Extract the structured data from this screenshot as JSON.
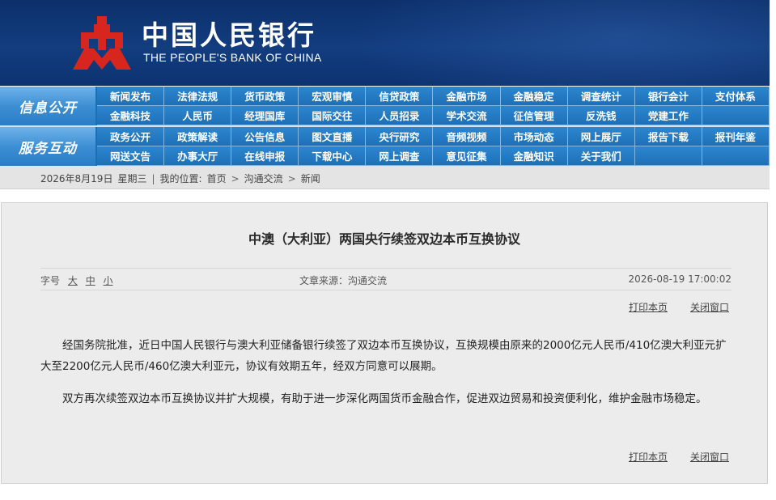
{
  "header": {
    "bank_name_cn": "中国人民银行",
    "bank_name_en": "THE PEOPLE'S BANK OF CHINA",
    "logo_icon": "pboc-logo-icon",
    "logo_color": "#d7261e"
  },
  "nav": {
    "info_label": "信息公开",
    "interact_label": "服务互动",
    "info_items": [
      "新闻发布",
      "法律法规",
      "货币政策",
      "宏观审慎",
      "信贷政策",
      "金融市场",
      "金融稳定",
      "调查统计",
      "银行会计",
      "支付体系",
      "金融科技",
      "人民币",
      "经理国库",
      "国际交往",
      "人员招录",
      "学术交流",
      "征信管理",
      "反洗钱",
      "党建工作",
      ""
    ],
    "interact_items": [
      "政务公开",
      "政策解读",
      "公告信息",
      "图文直播",
      "央行研究",
      "音频视频",
      "市场动态",
      "网上展厅",
      "报告下载",
      "报刊年鉴",
      "网送文告",
      "办事大厅",
      "在线申报",
      "下载中心",
      "网上调查",
      "意见征集",
      "金融知识",
      "关于我们",
      "",
      ""
    ]
  },
  "breadcrumb": {
    "date": "2026年8月19日",
    "weekday": "星期三",
    "divider": "|",
    "location_label": "我的位置:",
    "home": "首页",
    "arrow": ">",
    "section": "沟通交流",
    "page": "新闻"
  },
  "article": {
    "title": "中澳（大利亚）两国央行续签双边本币互换协议",
    "font_size_label": "字号",
    "font_large": "大",
    "font_medium": "中",
    "font_small": "小",
    "source": "文章来源：沟通交流",
    "timestamp": "2026-08-19  17:00:02",
    "print": "打印本页",
    "close": "关闭窗口",
    "paragraphs": [
      "经国务院批准，近日中国人民银行与澳大利亚储备银行续签了双边本币互换协议，互换规模由原来的2000亿元人民币/410亿澳大利亚元扩大至2200亿元人民币/460亿澳大利亚元，协议有效期五年，经双方同意可以展期。",
      "双方再次续签双边本币互换协议并扩大规模，有助于进一步深化两国货币金融合作，促进双边贸易和投资便利化，维护金融市场稳定。"
    ]
  }
}
